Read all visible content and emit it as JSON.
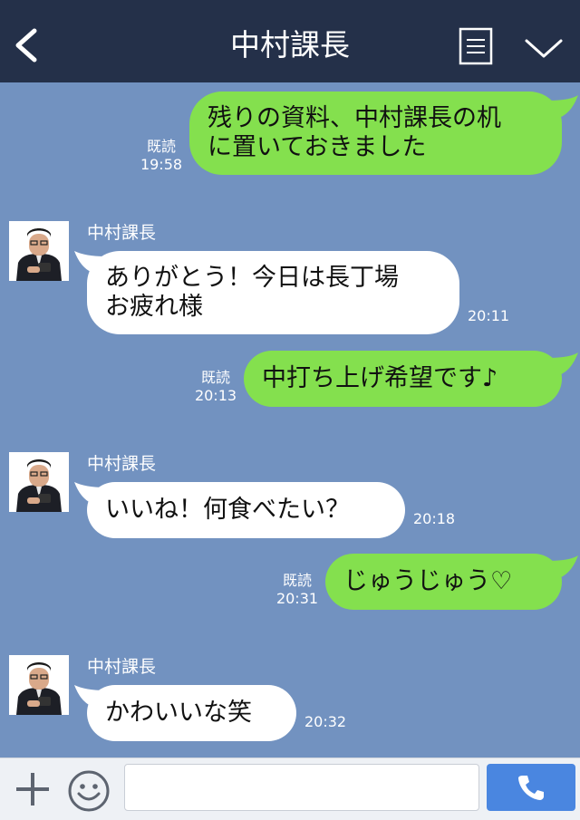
{
  "header": {
    "title": "中村課長"
  },
  "input": {
    "placeholder": ""
  },
  "messages": [
    {
      "direction": "out",
      "read": "既読",
      "time": "19:58",
      "lines": [
        "残りの資料、中村課長の机",
        "に置いておきました"
      ]
    },
    {
      "direction": "in",
      "sender": "中村課長",
      "time": "20:11",
      "lines": [
        "ありがとう！今日は長丁場",
        "お疲れ様"
      ]
    },
    {
      "direction": "out",
      "read": "既読",
      "time": "20:13",
      "lines": [
        "中打ち上げ希望です♪"
      ]
    },
    {
      "direction": "in",
      "sender": "中村課長",
      "time": "20:18",
      "lines": [
        "いいね！何食べたい？"
      ]
    },
    {
      "direction": "out",
      "read": "既読",
      "time": "20:31",
      "lines": [
        "じゅうじゅう♡"
      ]
    },
    {
      "direction": "in",
      "sender": "中村課長",
      "time": "20:32",
      "lines": [
        "かわいいな笑"
      ]
    }
  ],
  "colors": {
    "header_bg": "#243049",
    "chat_bg": "#7292c0",
    "outgoing_bubble": "#84e04e",
    "incoming_bubble": "#ffffff",
    "call_button": "#4a86e0"
  },
  "icons": [
    "back-icon",
    "note-icon",
    "chevron-down-icon",
    "plus-icon",
    "smile-icon",
    "phone-icon"
  ]
}
